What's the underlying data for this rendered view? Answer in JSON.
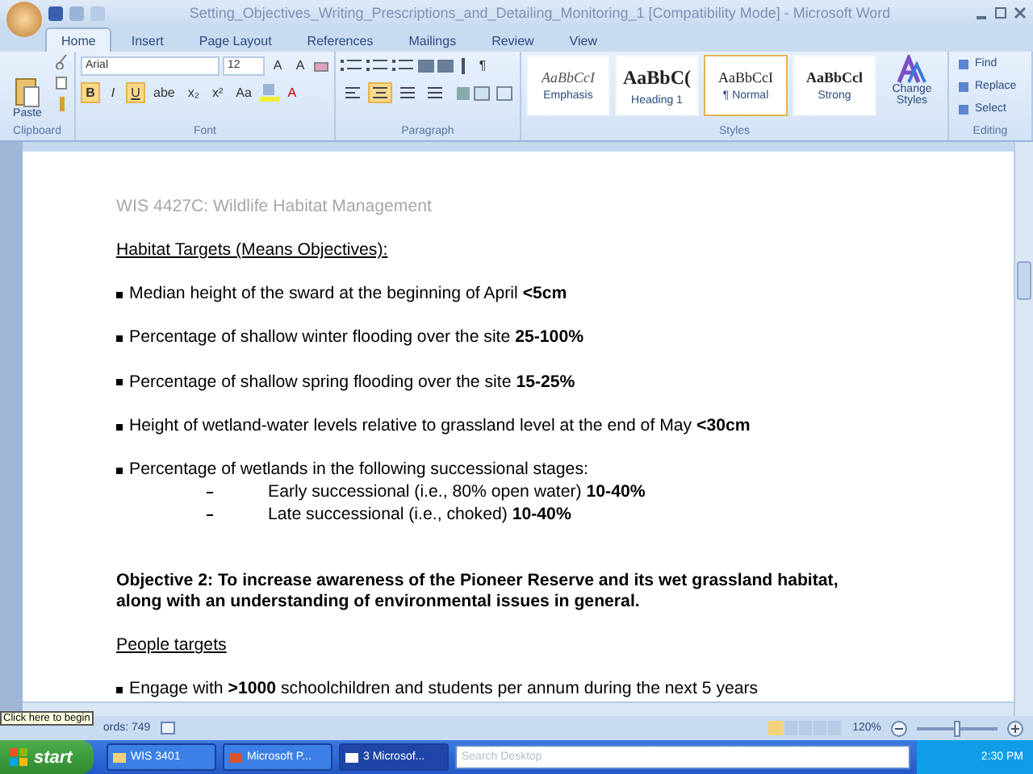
{
  "window": {
    "title": "Setting_Objectives_Writing_Prescriptions_and_Detailing_Monitoring_1 [Compatibility Mode] - Microsoft Word"
  },
  "tabs": [
    {
      "label": "Home",
      "selected": true
    },
    {
      "label": "Insert",
      "selected": false
    },
    {
      "label": "Page Layout",
      "selected": false
    },
    {
      "label": "References",
      "selected": false
    },
    {
      "label": "Mailings",
      "selected": false
    },
    {
      "label": "Review",
      "selected": false
    },
    {
      "label": "View",
      "selected": false
    }
  ],
  "ribbon": {
    "clipboard": {
      "paste": "Paste",
      "group": "Clipboard"
    },
    "font": {
      "name": "Arial",
      "size": "12",
      "grow": "A",
      "shrink": "A",
      "bold": "B",
      "italic": "I",
      "underline": "U",
      "strike": "abe",
      "sub": "x₂",
      "sup": "x²",
      "case": "Aa",
      "font_color_letter": "A",
      "group": "Font",
      "bold_on": true,
      "underline_on": true
    },
    "paragraph": {
      "group": "Paragraph",
      "pilcrow": "¶",
      "align": [
        {
          "selected": false
        },
        {
          "selected": true
        },
        {
          "selected": false
        },
        {
          "selected": false
        }
      ]
    },
    "styles": {
      "group": "Styles",
      "items": [
        {
          "preview": "AaBbCcI",
          "label": "Emphasis",
          "kind": "italic",
          "selected": false
        },
        {
          "preview": "AaBbC(",
          "label": "Heading 1",
          "kind": "heading",
          "selected": false
        },
        {
          "preview": "AaBbCcI",
          "label": "¶ Normal",
          "kind": "normal",
          "selected": true
        },
        {
          "preview": "AaBbCcl",
          "label": "Strong",
          "kind": "strong",
          "selected": false
        }
      ],
      "change": "Change Styles"
    },
    "editing": {
      "group": "Editing",
      "items": [
        "Find",
        "Replace",
        "Select"
      ]
    }
  },
  "document": {
    "header": "WIS 4427C: Wildlife Habitat Management",
    "heading": "Habitat Targets (Means Objectives):",
    "bullets": [
      {
        "text": "Median height of the sward at the beginning of April **<5cm**"
      },
      {
        "text": "Percentage of shallow winter flooding over the site **25-100%**"
      },
      {
        "text": "Percentage of shallow spring flooding over the site **15-25%**"
      },
      {
        "text": "Height of wetland-water levels relative to grassland level at the end of May **<30cm**"
      },
      {
        "text": "Percentage of wetlands in the following successional stages:",
        "children": [
          {
            "text": "Early successional (i.e., 80% open water) **10-40%**"
          },
          {
            "text": "Late successional (i.e., choked) **10-40%**"
          }
        ]
      }
    ],
    "objective": "Objective 2:  To increase awareness of the Pioneer Reserve and its wet grassland habitat, along with an understanding of environmental issues in general.",
    "people_heading": "People targets",
    "people_bullets": [
      {
        "text": "Engage with **>1000** schoolchildren and students per annum during the next 5 years"
      }
    ]
  },
  "status_bar": {
    "words": "ords: 749",
    "tooltip": "Click here to begin",
    "zoom": "120%",
    "zoom_level": {
      "level": 0.5
    }
  },
  "taskbar": {
    "start": "start",
    "tasks": [
      {
        "label": "WIS 3401",
        "selected": false
      },
      {
        "label": "Microsoft P...",
        "selected": false
      },
      {
        "label": "3 Microsof...",
        "selected": true
      }
    ],
    "search": {
      "placeholder": "Search Desktop"
    },
    "clock": "2:30 PM"
  }
}
